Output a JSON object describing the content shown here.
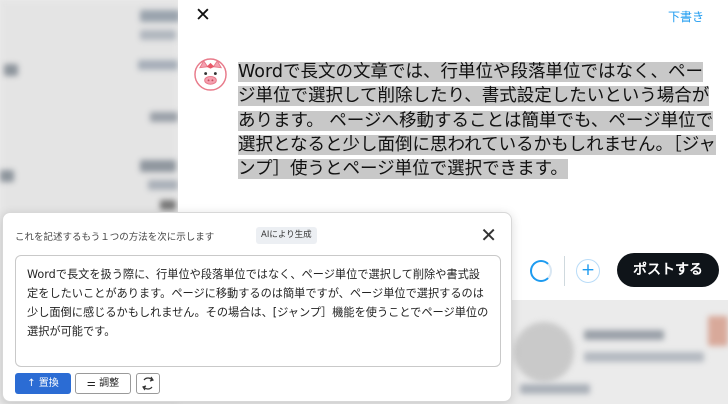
{
  "compose": {
    "close_icon": "close-icon",
    "draft_label": "下書き",
    "text": "Wordで長文の文章では、行単位や段落単位ではなく、ページ単位で選択して削除したり、書式設定したいという場合があります。 ページへ移動することは簡単でも、ページ単位で選択となると少し面倒に思われているかもしれません。［ジャンプ］使うとページ単位で選択できます。",
    "post_label": "ポストする",
    "add_icon": "plus-icon",
    "progress_icon": "character-count-ring"
  },
  "ai_popup": {
    "heading": "これを記述するもう１つの方法を次に示します",
    "badge": "AIにより生成",
    "suggestion": "Wordで長文を扱う際に、行単位や段落単位ではなく、ページ単位で選択して削除や書式設定をしたいことがあります。ページに移動するのは簡単ですが、ページ単位で選択するのは少し面倒に感じるかもしれません。その場合は、[ジャンプ］機能を使うことでページ単位の選択が可能です。",
    "replace_label": "置換",
    "adjust_label": "調整",
    "regenerate_icon": "refresh-icon"
  },
  "colors": {
    "accent": "#1d9bf0",
    "post_button": "#0f1419",
    "replace_button": "#2b6cd4",
    "selection": "#c8c8c8"
  }
}
